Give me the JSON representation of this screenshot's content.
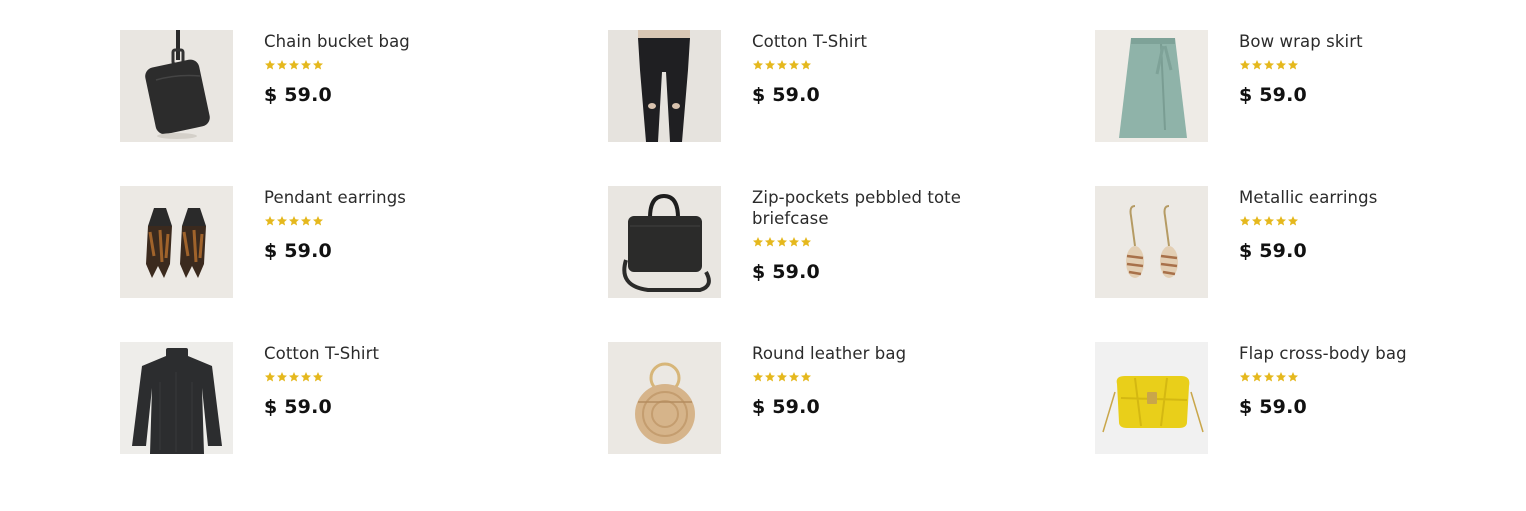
{
  "products": [
    {
      "title": "Chain bucket bag",
      "price": "$ 59.0",
      "rating": 5,
      "image_icon": "chain-bucket-bag-image",
      "bg": "#e9e6e1"
    },
    {
      "title": "Cotton T-Shirt",
      "price": "$ 59.0",
      "rating": 5,
      "image_icon": "jeans-image",
      "bg": "#e6e3de"
    },
    {
      "title": "Bow wrap skirt",
      "price": "$ 59.0",
      "rating": 5,
      "image_icon": "skirt-image",
      "bg": "#eeebe6"
    },
    {
      "title": "Pendant earrings",
      "price": "$ 59.0",
      "rating": 5,
      "image_icon": "pendant-earrings-image",
      "bg": "#ece9e4"
    },
    {
      "title": "Zip-pockets pebbled tote briefcase",
      "price": "$ 59.0",
      "rating": 5,
      "image_icon": "briefcase-image",
      "bg": "#e9e6e1"
    },
    {
      "title": "Metallic earrings",
      "price": "$ 59.0",
      "rating": 5,
      "image_icon": "metallic-earrings-image",
      "bg": "#ece9e4"
    },
    {
      "title": "Cotton T-Shirt",
      "price": "$ 59.0",
      "rating": 5,
      "image_icon": "turtleneck-image",
      "bg": "#eeedea"
    },
    {
      "title": "Round leather bag",
      "price": "$ 59.0",
      "rating": 5,
      "image_icon": "round-bag-image",
      "bg": "#ebe8e3"
    },
    {
      "title": "Flap cross-body bag",
      "price": "$ 59.0",
      "rating": 5,
      "image_icon": "yellow-bag-image",
      "bg": "#f1f1f1"
    }
  ],
  "colors": {
    "star": "#e5b81d",
    "price": "#111111",
    "title": "#2b2b2b"
  }
}
